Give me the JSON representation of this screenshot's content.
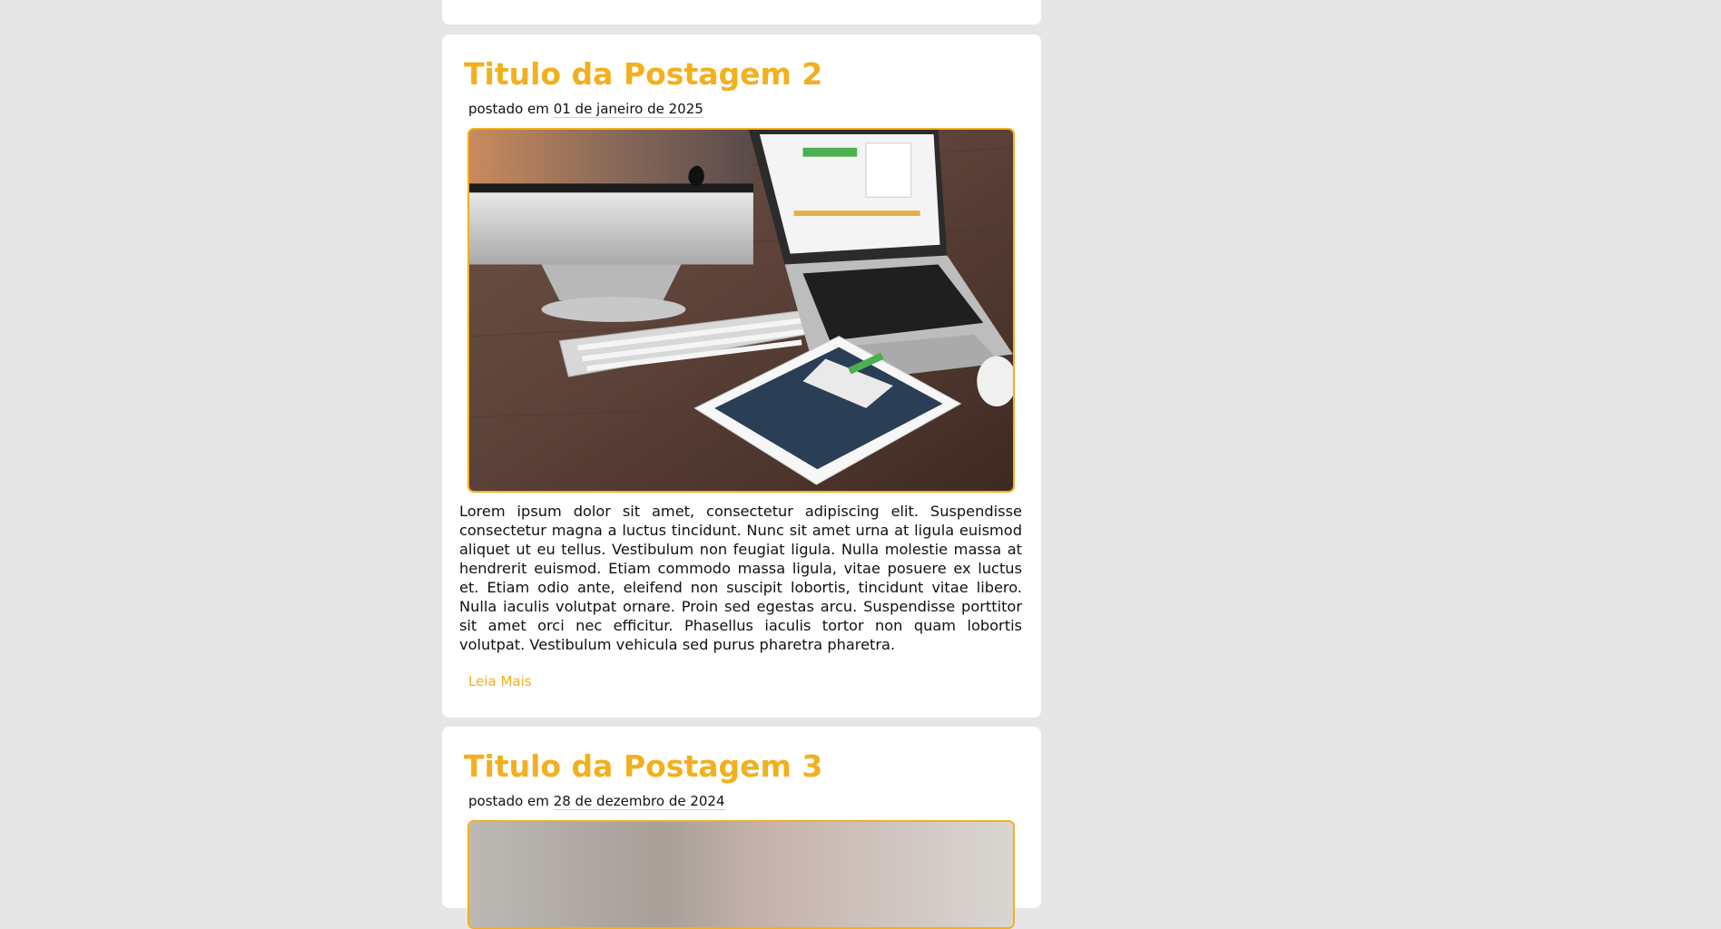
{
  "colors": {
    "accent": "#f2b01e",
    "background": "#e6e6e6",
    "card": "#ffffff",
    "text": "#111111"
  },
  "posts": [
    {
      "title": "Titulo da Postagem 2",
      "date_prefix": "postado em",
      "date": "01 de janeiro de 2025",
      "image": "workspace-devices-photo",
      "body": "Lorem ipsum dolor sit amet, consectetur adipiscing elit. Suspendisse consectetur magna a luctus tincidunt. Nunc sit amet urna at ligula euismod aliquet ut eu tellus. Vestibulum non feugiat ligula. Nulla molestie massa at hendrerit euismod. Etiam commodo massa ligula, vitae posuere ex luctus et. Etiam odio ante, eleifend non suscipit lobortis, tincidunt vitae libero. Nulla iaculis volutpat ornare. Proin sed egestas arcu. Suspendisse porttitor sit amet orci nec efficitur. Phasellus iaculis tortor non quam lobortis volutpat. Vestibulum vehicula sed purus pharetra pharetra.",
      "read_more": "Leia Mais"
    },
    {
      "title": "Titulo da Postagem 3",
      "date_prefix": "postado em",
      "date": "28 de dezembro de 2024",
      "image": "blurred-photo"
    }
  ]
}
